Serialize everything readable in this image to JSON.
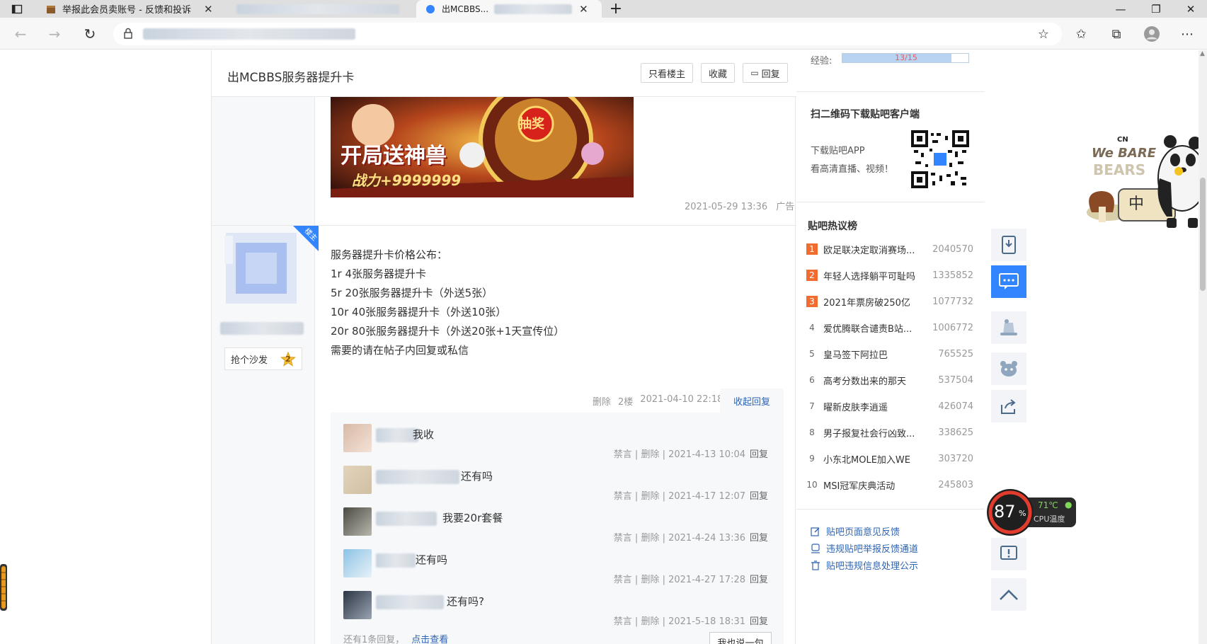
{
  "browser": {
    "tabs": [
      {
        "title": "举报此会员卖账号 - 反馈和投诉",
        "active": false
      },
      {
        "title": "",
        "active": false
      },
      {
        "title": "出MCBBS...",
        "active": true
      }
    ],
    "new_tab": "+",
    "url": "https://tieba.baidu.com/..."
  },
  "thread": {
    "title": "出MCBBS服务器提升卡",
    "buttons": {
      "only_op": "只看楼主",
      "favorite": "收藏",
      "reply": "回复"
    }
  },
  "ad": {
    "banner_text_1": "开局送神兽",
    "banner_text_2": "战力+9999999",
    "banner_text_3": "抽奖",
    "time": "2021-05-29 13:36",
    "label": "广告"
  },
  "post": {
    "op_tag": "楼主",
    "sofa_label": "抢个沙发",
    "sofa_count": "2",
    "lines": [
      "服务器提升卡价格公布：",
      "1r 4张服务器提升卡",
      "5r 20张服务器提升卡（外送5张）",
      "10r 40张服务器提升卡（外送10张）",
      "20r 80张服务器提升卡（外送20张+1天宣传位）",
      "需要的请在帖子内回复或私信"
    ],
    "meta": {
      "delete": "删除",
      "floor": "2楼",
      "time": "2021-04-10 22:18"
    },
    "collapse": "收起回复"
  },
  "replies": [
    {
      "text": "我收",
      "ban": "禁言",
      "del": "删除",
      "time": "2021-4-13 10:04",
      "reply": "回复"
    },
    {
      "text": "还有吗",
      "ban": "禁言",
      "del": "删除",
      "time": "2021-4-17 12:07",
      "reply": "回复"
    },
    {
      "text": "我要20r套餐",
      "ban": "禁言",
      "del": "删除",
      "time": "2021-4-24 13:36",
      "reply": "回复"
    },
    {
      "text": "还有吗",
      "ban": "禁言",
      "del": "删除",
      "time": "2021-4-27 17:28",
      "reply": "回复"
    },
    {
      "text": "还有吗?",
      "ban": "禁言",
      "del": "删除",
      "time": "2021-5-18 18:31",
      "reply": "回复"
    }
  ],
  "replies_footer": {
    "more": "还有1条回复，",
    "view": "点击查看",
    "say": "我也说一句"
  },
  "sidebar": {
    "exp_label": "经验:",
    "exp_value": "13/15",
    "qr_title": "扫二维码下载贴吧客户端",
    "qr_line1": "下载贴吧APP",
    "qr_line2": "看高清直播、视频！",
    "hot_title": "贴吧热议榜",
    "hot": [
      {
        "rank": "1",
        "title": "欧足联决定取消赛场...",
        "num": "2040570"
      },
      {
        "rank": "2",
        "title": "年轻人选择躺平可耻吗",
        "num": "1335852"
      },
      {
        "rank": "3",
        "title": "2021年票房破250亿",
        "num": "1077732"
      },
      {
        "rank": "4",
        "title": "爱优腾联合谴责B站...",
        "num": "1006772"
      },
      {
        "rank": "5",
        "title": "皇马签下阿拉巴",
        "num": "765525"
      },
      {
        "rank": "6",
        "title": "高考分数出来的那天",
        "num": "537504"
      },
      {
        "rank": "7",
        "title": "曜新皮肤李逍遥",
        "num": "426074"
      },
      {
        "rank": "8",
        "title": "男子报复社会行凶致...",
        "num": "338625"
      },
      {
        "rank": "9",
        "title": "小东北MOLE加入WE",
        "num": "303720"
      },
      {
        "rank": "10",
        "title": "MSI冠军庆典活动",
        "num": "245803"
      }
    ],
    "links": [
      "贴吧页面意见反馈",
      "违规贴吧举报反馈通道",
      "贴吧违规信息处理公示"
    ]
  },
  "cpu": {
    "percent": "87",
    "unit": "%",
    "temp": "71℃",
    "label": "CPU温度"
  },
  "mascot": {
    "brand": "CN",
    "line1": "We BARE",
    "line2": "BEARS",
    "text_zh": "中"
  },
  "colors": {
    "accent": "#3385ff",
    "link": "#2d64b3",
    "rank_top": "#f26c30"
  }
}
